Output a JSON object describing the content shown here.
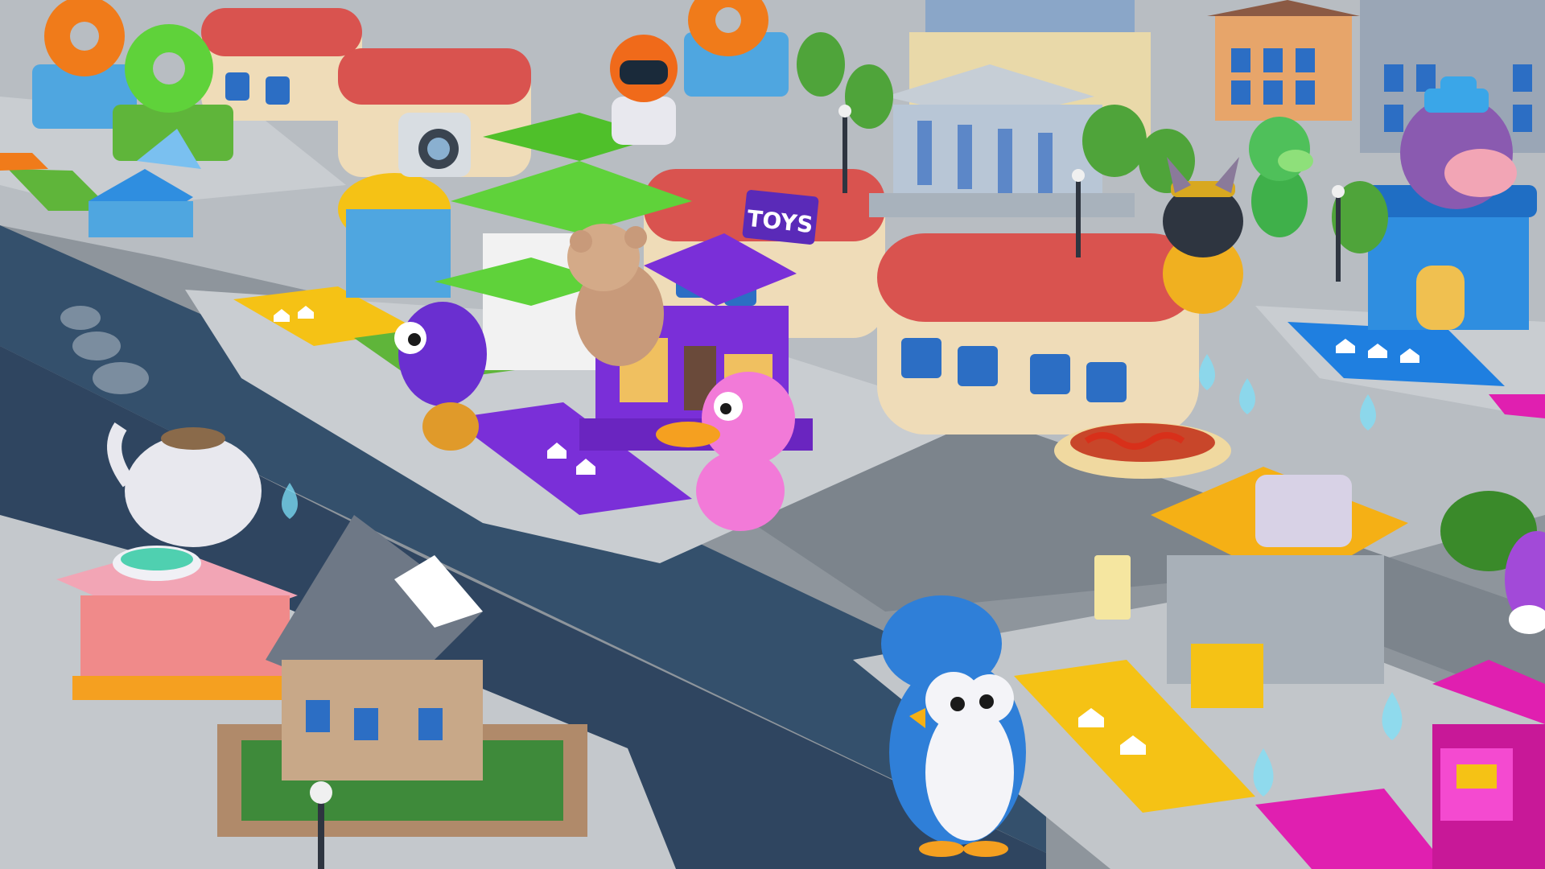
{
  "signs": {
    "toy_shop": "TOYS"
  },
  "colors": {
    "street": "#2f4560",
    "pavement": "#9aa1a8",
    "sidewalk": "#c9cdd1",
    "board_yellow": "#f5c215",
    "board_purple": "#7a2fd8",
    "board_blue": "#1f7fe0",
    "board_magenta": "#e01fb0",
    "board_green": "#5fb53a",
    "train_roof": "#d9534f",
    "train_body": "#efdcb8"
  },
  "characters": [
    {
      "id": "penguin",
      "color": "#2f7fd8"
    },
    {
      "id": "pink-duck",
      "color": "#f27ad8"
    },
    {
      "id": "purple-bird",
      "color": "#6a2fd0"
    },
    {
      "id": "dog",
      "color": "#2e3540"
    },
    {
      "id": "green-donkey",
      "color": "#3fb04a"
    },
    {
      "id": "robot",
      "color": "#f06a1a"
    },
    {
      "id": "cow",
      "color": "#8a5ab0"
    }
  ]
}
